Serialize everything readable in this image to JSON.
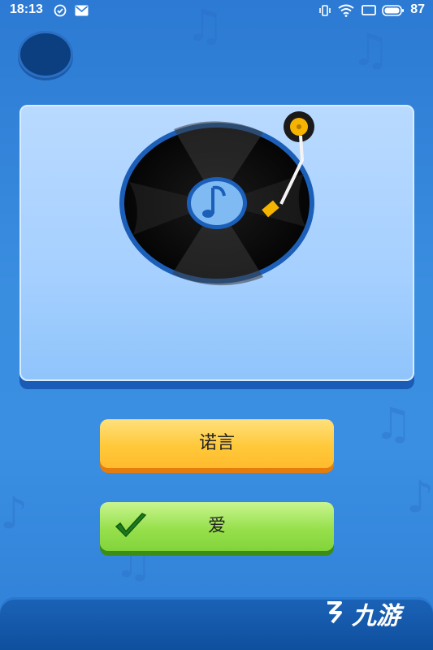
{
  "status_bar": {
    "time": "18:13",
    "battery": "87"
  },
  "answers": [
    {
      "label": "诺言",
      "color": "#ffc93a"
    },
    {
      "label": "爱",
      "color": "#97e04c",
      "checked": true
    }
  ],
  "icons": [
    "vibrate-icon",
    "wifi-icon",
    "screen-cast-icon",
    "battery-icon",
    "check-circle-icon",
    "mail-icon",
    "vinyl-record-icon",
    "music-note-icon",
    "tonearm-icon",
    "checkmark-icon"
  ],
  "watermark": {
    "text": "九游"
  }
}
